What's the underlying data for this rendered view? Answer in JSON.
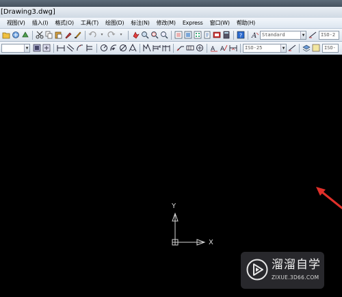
{
  "window": {
    "title": "[Drawing3.dwg]"
  },
  "menubar": {
    "items": [
      {
        "label": "视图(V)"
      },
      {
        "label": "插入(I)"
      },
      {
        "label": "格式(O)"
      },
      {
        "label": "工具(T)"
      },
      {
        "label": "绘图(D)"
      },
      {
        "label": "标注(N)"
      },
      {
        "label": "修改(M)"
      },
      {
        "label": "Express"
      },
      {
        "label": "窗口(W)"
      },
      {
        "label": "帮助(H)"
      }
    ]
  },
  "toolbar1": {
    "text_style_combo": "Standard",
    "dim_style_combo": "ISO-2"
  },
  "toolbar2": {
    "dim_style_combo": "ISO-25",
    "right_combo": "ISO-"
  },
  "ucs": {
    "x_label": "X",
    "y_label": "Y"
  },
  "watermark": {
    "title": "溜溜自学",
    "url": "ZIXUE.3D66.COM"
  },
  "colors": {
    "canvas": "#000000",
    "arrow": "#e0302a",
    "ucs": "#d8d8d8"
  }
}
